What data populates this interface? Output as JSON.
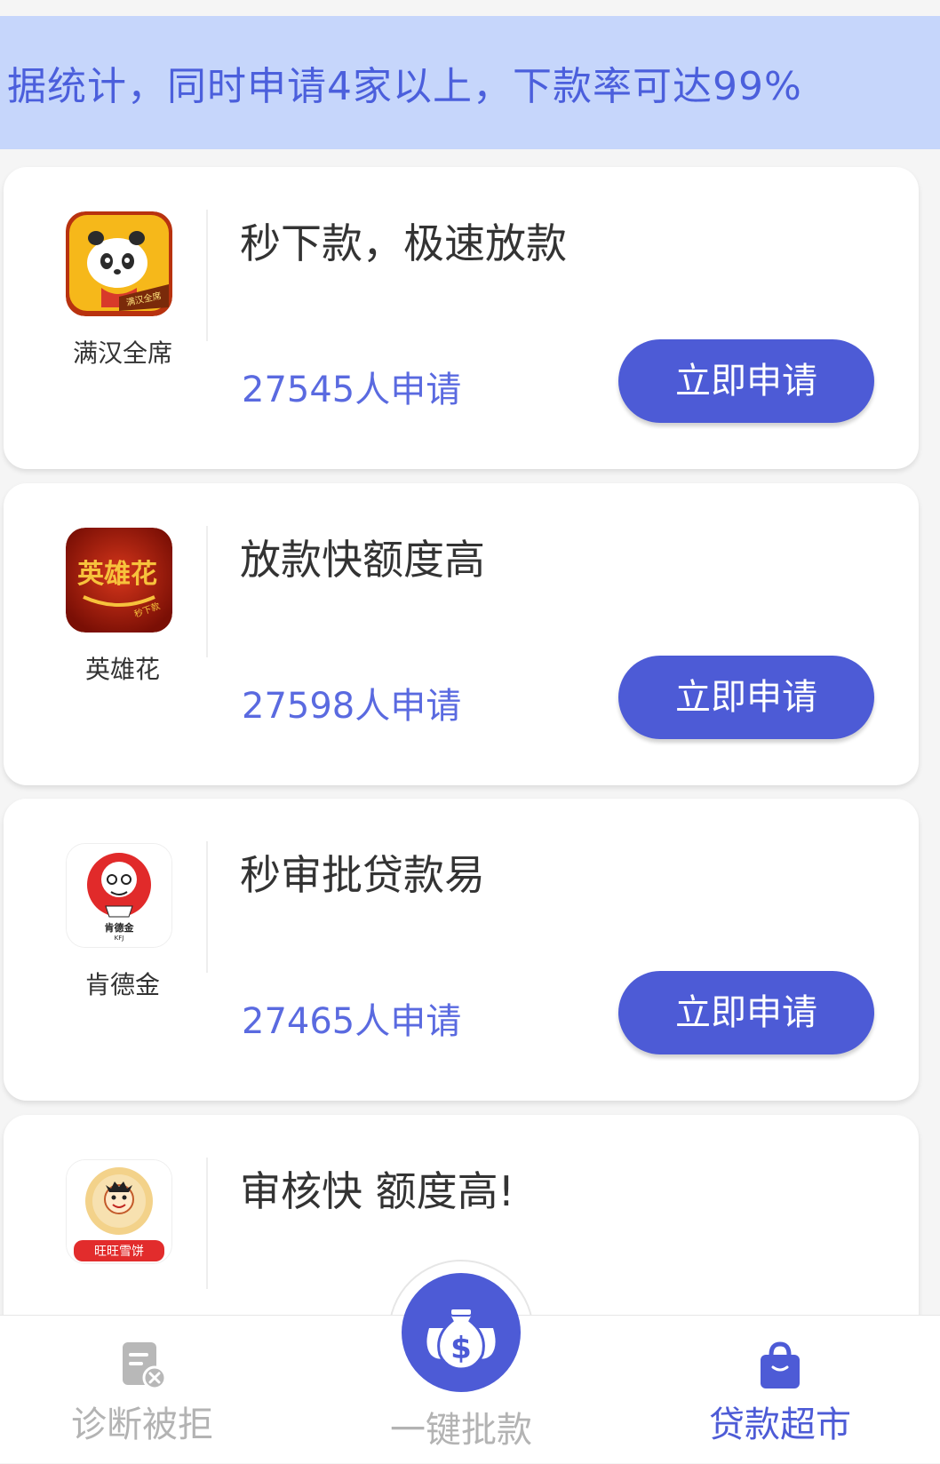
{
  "banner": {
    "text": "据统计，同时申请4家以上，下款率可达99%"
  },
  "cards": [
    {
      "name": "满汉全席",
      "title": "秒下款，极速放款",
      "applicants": "27545人申请",
      "button": "立即申请",
      "logo_badge": "满汉全席"
    },
    {
      "name": "英雄花",
      "title": "放款快额度高",
      "applicants": "27598人申请",
      "button": "立即申请",
      "logo_text": "英雄花",
      "logo_badge": "秒下款"
    },
    {
      "name": "肯德金",
      "title": "秒审批贷款易",
      "applicants": "27465人申请",
      "button": "立即申请",
      "logo_text": "肯德金",
      "logo_sub": "KFJ"
    },
    {
      "name": "旺旺雪饼",
      "title": "审核快  额度高!",
      "logo_text": "旺旺雪饼"
    }
  ],
  "tabbar": {
    "tabs": [
      {
        "label": "诊断被拒",
        "icon": "document-reject-icon",
        "color": "#b3b3b3"
      },
      {
        "label": "一键批款",
        "icon": "money-bags-icon",
        "color": "#b3b3b3"
      },
      {
        "label": "贷款超市",
        "icon": "shopping-bag-icon",
        "color": "#4d5bd6"
      }
    ]
  },
  "colors": {
    "accent": "#4d5bd6",
    "banner_bg": "#c6d6fb",
    "link": "#5a6ae0"
  }
}
